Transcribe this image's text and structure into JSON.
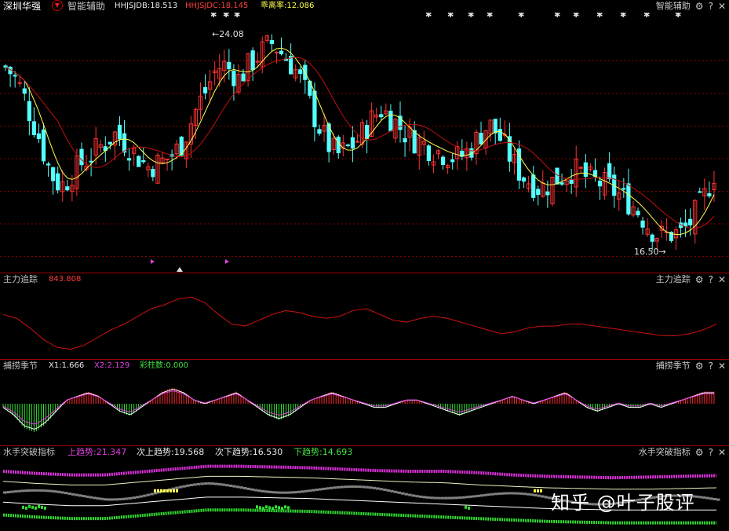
{
  "header": {
    "stock_name": "深圳华强",
    "dropdown_icon": "chevron-down-circle-icon",
    "indicator_name": "智能辅助",
    "hhjsjdb": "HHJSJDB:18.513",
    "hhjsjdc": "HHJSJDC:18.145",
    "deviation_rate": "乖离率:12.086",
    "right_title": "智能辅助",
    "controls": [
      "gear-icon",
      "help-icon",
      "close-icon"
    ]
  },
  "price_chart": {
    "high_label": "24.08",
    "low_label": "16.50",
    "high_value": 24.08,
    "low_value": 16.5
  },
  "panel2": {
    "title": "主力追踪",
    "value": "843.808",
    "right_title": "主力追踪"
  },
  "panel3": {
    "title": "捕捞季节",
    "x1": "X1:1.666",
    "x2": "X2:2.129",
    "color_bars": "彩柱数:0.000",
    "right_title": "捕捞季节"
  },
  "panel4": {
    "title": "水手突破指标",
    "up_trend": "上趋势:21.347",
    "sub_up_trend": "次上趋势:19.568",
    "sub_down_trend": "次下趋势:16.530",
    "down_trend": "下趋势:14.693",
    "right_title": "水手突破指标"
  },
  "watermark": "知乎 @叶子股评",
  "colors": {
    "up": "#ff3232",
    "down": "#54ffff",
    "ma_yellow": "#ffff50",
    "ma_red": "#c01010",
    "grid": "#8a0000",
    "magenta": "#e030e0",
    "green": "#33dd33"
  },
  "chart_data": [
    {
      "type": "candlestick",
      "title": "深圳华强",
      "annotations": [
        "24.08",
        "16.50"
      ],
      "ylim": [
        16.5,
        24.08
      ],
      "close": [
        22.8,
        22.5,
        22.0,
        21.2,
        20.5,
        19.6,
        19.0,
        18.9,
        19.3,
        19.6,
        19.8,
        20.1,
        20.3,
        20.6,
        20.4,
        20.1,
        19.8,
        19.5,
        19.6,
        19.7,
        19.9,
        20.2,
        20.8,
        21.5,
        22.0,
        22.6,
        22.9,
        22.7,
        22.4,
        22.8,
        23.1,
        23.4,
        23.6,
        23.3,
        23.0,
        22.6,
        22.0,
        21.2,
        20.6,
        20.1,
        19.9,
        20.1,
        20.3,
        20.7,
        21.1,
        21.4,
        21.2,
        20.9,
        20.6,
        20.4,
        20.3,
        20.1,
        20.0,
        19.9,
        19.8,
        19.9,
        20.2,
        20.6,
        20.9,
        20.6,
        20.1,
        19.6,
        19.2,
        19.0,
        18.8,
        18.9,
        19.1,
        19.2,
        19.4,
        19.3,
        19.1,
        19.0,
        18.9,
        18.7,
        18.5,
        18.3,
        18.0,
        17.6,
        17.3,
        17.2,
        17.3,
        17.3,
        17.6,
        18.1,
        18.6,
        19.3
      ]
    },
    {
      "type": "line",
      "title": "主力追踪",
      "series": [
        {
          "name": "主力追踪",
          "values": [
            62,
            58,
            48,
            36,
            28,
            26,
            30,
            38,
            46,
            52,
            60,
            68,
            72,
            78,
            80,
            74,
            62,
            52,
            50,
            56,
            62,
            66,
            64,
            60,
            58,
            60,
            66,
            68,
            62,
            56,
            54,
            58,
            60,
            58,
            54,
            50,
            46,
            42,
            44,
            48,
            50,
            50,
            52,
            52,
            50,
            48,
            46,
            44,
            42,
            40,
            40,
            42,
            46,
            52
          ]
        }
      ]
    },
    {
      "type": "bar",
      "title": "捕捞季节",
      "series": [
        {
          "name": "捕捞季节",
          "values": [
            -1,
            -3,
            -6,
            -7,
            -5,
            -2,
            1,
            2,
            3,
            2,
            0,
            -2,
            -3,
            -1,
            1,
            3,
            4,
            3,
            1,
            0,
            1,
            2,
            3,
            1,
            -1,
            -3,
            -4,
            -3,
            -1,
            1,
            2,
            3,
            2,
            1,
            0,
            -1,
            -1,
            0,
            1,
            1,
            0,
            -1,
            -2,
            -3,
            -2,
            -1,
            0,
            1,
            2,
            1,
            0,
            1,
            2,
            3,
            1,
            -1,
            -2,
            -1,
            0,
            -1,
            -1,
            0,
            -1,
            0,
            1,
            2,
            3,
            3
          ]
        }
      ]
    },
    {
      "type": "line",
      "title": "水手突破指标",
      "series": [
        {
          "name": "上趋势",
          "values": [
            21.9,
            21.6,
            21.4,
            21.4,
            21.8,
            22.2,
            22.6,
            22.6,
            22.5,
            22.4,
            22.2,
            22.0,
            21.9,
            21.9,
            21.7,
            21.4,
            21.2,
            21.1,
            21.0,
            21.1,
            21.2,
            21.3
          ]
        },
        {
          "name": "次上趋势",
          "values": [
            20.5,
            20.2,
            20.0,
            20.0,
            20.4,
            20.8,
            21.2,
            21.2,
            21.1,
            21.0,
            20.8,
            20.6,
            20.4,
            20.3,
            20.0,
            19.8,
            19.6,
            19.5,
            19.4,
            19.4,
            19.5,
            19.6
          ]
        },
        {
          "name": "次下趋势",
          "values": [
            17.6,
            17.3,
            17.1,
            17.1,
            17.5,
            17.9,
            18.3,
            18.3,
            18.2,
            18.1,
            17.9,
            17.7,
            17.5,
            17.3,
            17.1,
            16.9,
            16.7,
            16.6,
            16.5,
            16.5,
            16.5,
            16.5
          ]
        },
        {
          "name": "下趋势",
          "values": [
            15.8,
            15.5,
            15.3,
            15.3,
            15.7,
            16.1,
            16.5,
            16.5,
            16.4,
            16.3,
            16.1,
            15.9,
            15.7,
            15.5,
            15.3,
            15.1,
            14.9,
            14.8,
            14.7,
            14.7,
            14.7,
            14.7
          ]
        }
      ]
    }
  ]
}
